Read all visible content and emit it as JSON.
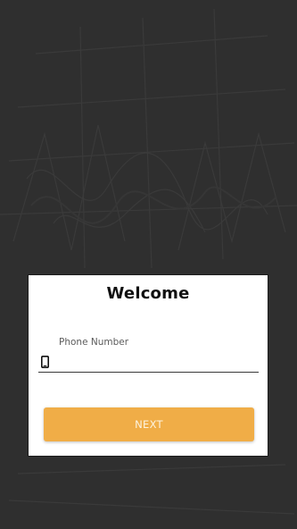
{
  "dialog": {
    "title": "Welcome",
    "phone_field": {
      "label": "Phone Number",
      "value": "",
      "icon": "mobile-phone-icon"
    },
    "next_button": {
      "label": "NEXT"
    }
  },
  "colors": {
    "background": "#2f2f2f",
    "dialog_background": "#ffffff",
    "accent": "#f0ad47",
    "button_text": "#fdf3df"
  }
}
